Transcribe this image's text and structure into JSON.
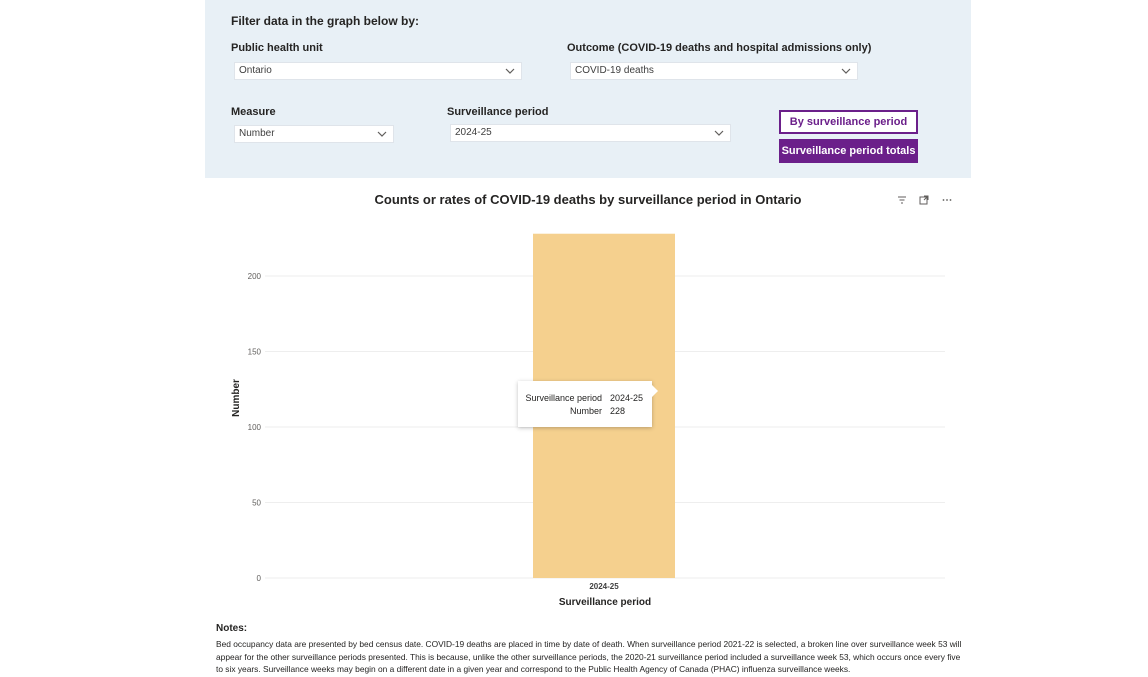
{
  "filters": {
    "heading": "Filter data in the graph below by:",
    "public_health_unit": {
      "label": "Public health unit",
      "value": "Ontario"
    },
    "outcome": {
      "label": "Outcome (COVID-19 deaths and hospital admissions only)",
      "value": "COVID-19 deaths"
    },
    "measure": {
      "label": "Measure",
      "value": "Number"
    },
    "surveillance_period": {
      "label": "Surveillance period",
      "value": "2024-25"
    },
    "buttons": {
      "by_period": "By surveillance period",
      "totals": "Surveillance period totals"
    }
  },
  "colors": {
    "accent": "#6b1f8a",
    "bar": "#f5d08e",
    "panel": "#e8f0f6"
  },
  "chart_data": {
    "type": "bar",
    "title": "Counts or rates of COVID-19 deaths by surveillance period in Ontario",
    "xlabel": "Surveillance period",
    "ylabel": "Number",
    "categories": [
      "2024-25"
    ],
    "values": [
      228
    ],
    "ylim": [
      0,
      200
    ],
    "yticks": [
      0,
      50,
      100,
      150,
      200
    ],
    "grid": true
  },
  "tooltip": {
    "period_label": "Surveillance period",
    "period_value": "2024-25",
    "measure_label": "Number",
    "measure_value": "228"
  },
  "notes": {
    "title": "Notes:",
    "text": "Bed occupancy data are presented by bed census date. COVID-19 deaths are placed in time by date of death. When surveillance period 2021-22 is selected, a broken line over surveillance week 53 will appear for the other surveillance periods presented. This is because, unlike the other surveillance periods, the 2020-21 surveillance period included a surveillance week 53, which occurs once every five to six years. Surveillance weeks may begin on a different date in a given year and correspond to the Public Health Agency of Canada (PHAC) influenza surveillance weeks."
  },
  "icons": [
    "filter-icon",
    "focus-mode-icon",
    "more-options-icon"
  ]
}
